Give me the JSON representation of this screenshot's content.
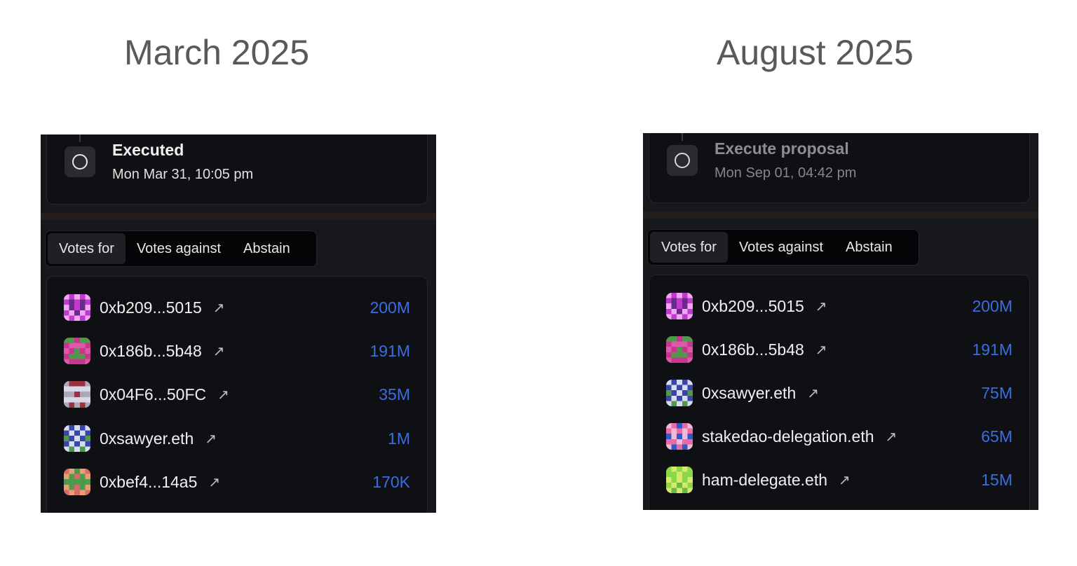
{
  "left": {
    "heading": "March 2025",
    "status": {
      "title": "Executed",
      "date": "Mon Mar 31, 10:05 pm"
    },
    "tabs": [
      "Votes for",
      "Votes against",
      "Abstain"
    ],
    "votes": [
      {
        "voter": "0xb209...5015",
        "amount": "200M",
        "icon": "pixel-avatar-magenta"
      },
      {
        "voter": "0x186b...5b48",
        "amount": "191M",
        "icon": "pixel-avatar-pink-green"
      },
      {
        "voter": "0x04F6...50FC",
        "amount": "35M",
        "icon": "pixel-avatar-gray-red"
      },
      {
        "voter": "0xsawyer.eth",
        "amount": "1M",
        "icon": "pixel-avatar-blue-white"
      },
      {
        "voter": "0xbef4...14a5",
        "amount": "170K",
        "icon": "pixel-avatar-green-coral"
      }
    ]
  },
  "right": {
    "heading": "August 2025",
    "status": {
      "title": "Execute proposal",
      "date": "Mon Sep 01, 04:42 pm"
    },
    "tabs": [
      "Votes for",
      "Votes against",
      "Abstain"
    ],
    "votes": [
      {
        "voter": "0xb209...5015",
        "amount": "200M",
        "icon": "pixel-avatar-magenta"
      },
      {
        "voter": "0x186b...5b48",
        "amount": "191M",
        "icon": "pixel-avatar-pink-green"
      },
      {
        "voter": "0xsawyer.eth",
        "amount": "75M",
        "icon": "pixel-avatar-blue-white"
      },
      {
        "voter": "stakedao-delegation.eth",
        "amount": "65M",
        "icon": "pixel-avatar-blue-pink"
      },
      {
        "voter": "ham-delegate.eth",
        "amount": "15M",
        "icon": "pixel-avatar-lime"
      }
    ]
  },
  "colors": {
    "amount": "#3b6de0",
    "panel_bg": "#17181b",
    "card_bg": "#0f1014"
  }
}
